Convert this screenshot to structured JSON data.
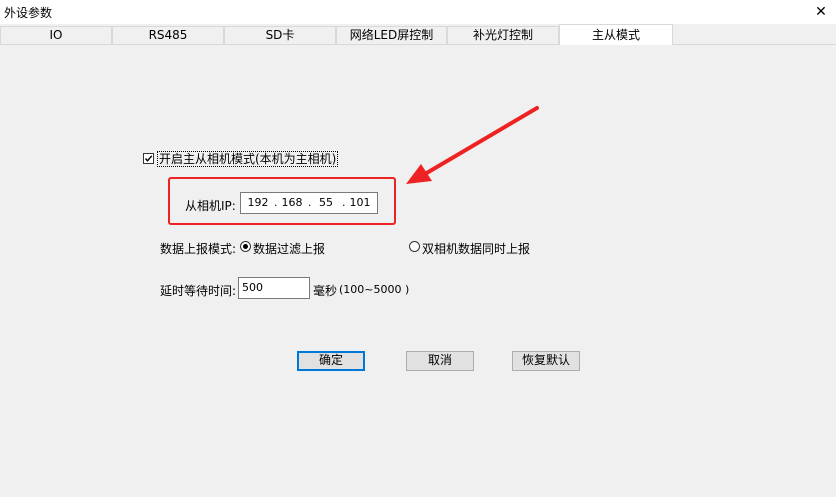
{
  "window": {
    "title": "外设参数",
    "close_glyph": "✕"
  },
  "tabs": [
    {
      "label": "IO"
    },
    {
      "label": "RS485"
    },
    {
      "label": "SD卡"
    },
    {
      "label": "网络LED屏控制"
    },
    {
      "label": "补光灯控制"
    },
    {
      "label": "主从模式",
      "active": true
    }
  ],
  "master_slave": {
    "enable_label": "开启主从相机模式(本机为主相机)",
    "enable_checked": true,
    "slave_ip_label": "从相机IP:",
    "slave_ip": [
      "192",
      "168",
      "55",
      "101"
    ],
    "report_mode_label": "数据上报模式:",
    "report_options": [
      {
        "label": "数据过滤上报",
        "selected": true
      },
      {
        "label": "双相机数据同时上报",
        "selected": false
      }
    ],
    "delay_label": "延时等待时间:",
    "delay_value": "500",
    "delay_unit": "毫秒",
    "delay_range": "(100~5000 )"
  },
  "buttons": {
    "ok": "确定",
    "cancel": "取消",
    "restore": "恢复默认"
  },
  "colors": {
    "annotation_red": "#ee2222",
    "focus_blue": "#0078d7"
  }
}
